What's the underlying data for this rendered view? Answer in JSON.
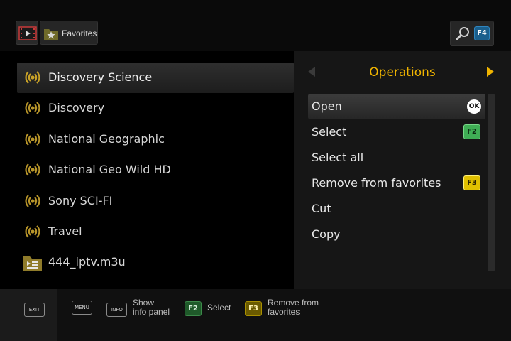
{
  "header": {
    "video_icon": "video-play-icon",
    "favorites_label": "Favorites",
    "search_icon": "magnifier-icon",
    "search_key": "F4"
  },
  "channels": [
    {
      "label": "Discovery Science",
      "icon": "broadcast-icon",
      "selected": true
    },
    {
      "label": "Discovery",
      "icon": "broadcast-icon"
    },
    {
      "label": "National Geographic",
      "icon": "broadcast-icon"
    },
    {
      "label": "National Geo Wild HD",
      "icon": "broadcast-icon"
    },
    {
      "label": "Sony SCI-FI",
      "icon": "broadcast-icon"
    },
    {
      "label": "Travel",
      "icon": "broadcast-icon"
    },
    {
      "label": "444_iptv.m3u",
      "icon": "playlist-folder-icon"
    }
  ],
  "operations": {
    "title": "Operations",
    "items": [
      {
        "label": "Open",
        "key": "OK",
        "selected": true
      },
      {
        "label": "Select",
        "key": "F2"
      },
      {
        "label": "Select all"
      },
      {
        "label": "Remove from favorites",
        "key": "F3"
      },
      {
        "label": "Cut"
      },
      {
        "label": "Copy"
      }
    ]
  },
  "footer": {
    "exit": "EXIT",
    "menu": "MENU",
    "info": "INFO",
    "show_info_line1": "Show",
    "show_info_line2": "info panel",
    "f2_key": "F2",
    "f2_label": "Select",
    "f3_key": "F3",
    "f3_line1": "Remove from",
    "f3_line2": "favorites"
  },
  "colors": {
    "accent": "#f0b400",
    "key_green": "#3fae55",
    "key_yellow": "#e0c000",
    "key_blue": "#1b5f8c"
  }
}
